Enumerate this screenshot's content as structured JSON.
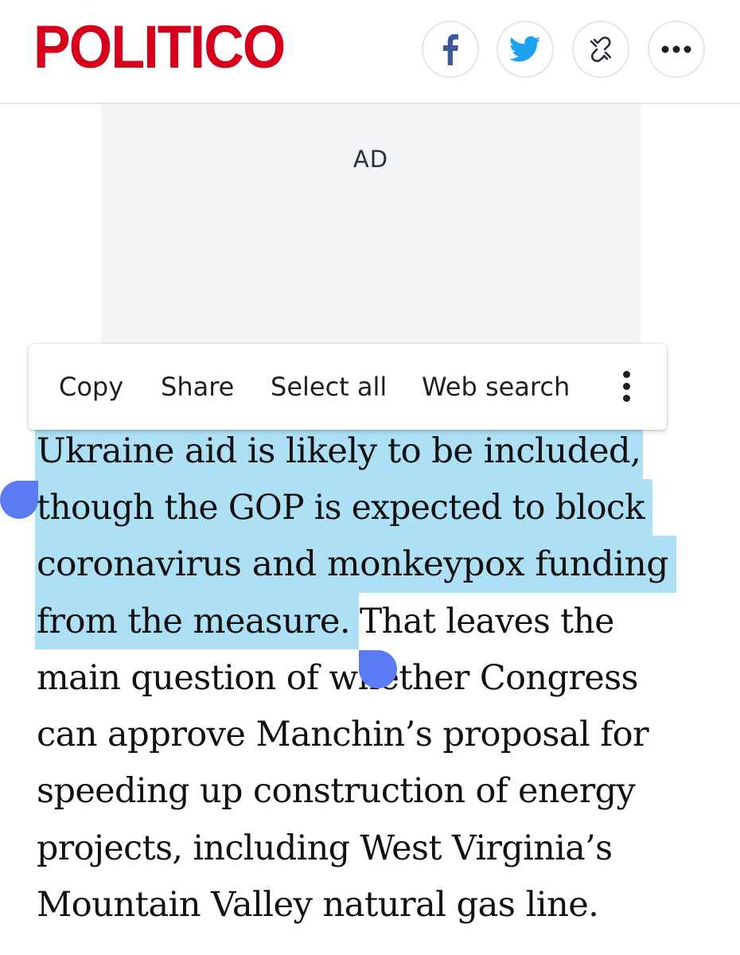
{
  "header": {
    "logo_text": "POLITICO",
    "logo_color": "#d6001c",
    "share_buttons": [
      {
        "icon": "facebook-icon",
        "color": "#3b5998"
      },
      {
        "icon": "twitter-icon",
        "color": "#1da1f2"
      },
      {
        "icon": "link-icon",
        "color": "#2a2f3a"
      },
      {
        "icon": "more-icon",
        "color": "#1f1f1f"
      }
    ]
  },
  "ad": {
    "label": "AD"
  },
  "selection_toolbar": {
    "copy": "Copy",
    "share": "Share",
    "select_all": "Select all",
    "web_search": "Web search",
    "more_icon": "more-vertical-icon"
  },
  "article": {
    "lines": [
      "Ukraine aid is likely to be included,",
      "though the GOP is expected to block",
      "coronavirus and monkeypox funding",
      "from the measure.",
      "That leaves the",
      "main question of whether Congress",
      "can approve Manchin’s proposal for",
      "speeding up construction of energy",
      "projects, including West Virginia’s",
      "Mountain Valley natural gas line."
    ],
    "selection_color": "#aee0f5",
    "handle_color": "#5b7bf5"
  }
}
